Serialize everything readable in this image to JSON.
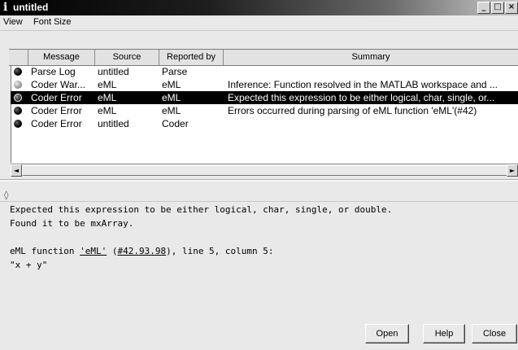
{
  "window": {
    "title": "untitled",
    "app_icon": "matlab-info-icon"
  },
  "window_buttons": {
    "minimize": "_",
    "maximize": "□",
    "close": "×"
  },
  "menu": [
    "View",
    "Font Size"
  ],
  "table": {
    "columns": [
      "Message",
      "Source",
      "Reported by",
      "Summary"
    ],
    "rows": [
      {
        "icon": "dark",
        "message": "Parse Log",
        "source": "untitled",
        "reported_by": "Parse",
        "summary": "",
        "selected": false
      },
      {
        "icon": "light",
        "message": "Coder War...",
        "source": "eML",
        "reported_by": "eML",
        "summary": "Inference: Function resolved in the MATLAB workspace and ...",
        "selected": false
      },
      {
        "icon": "dark",
        "message": "Coder Error",
        "source": "eML",
        "reported_by": "eML",
        "summary": "Expected this expression to be either logical, char, single, or...",
        "selected": true
      },
      {
        "icon": "dark",
        "message": "Coder Error",
        "source": "eML",
        "reported_by": "eML",
        "summary": "Errors occurred during parsing of eML function 'eML'(#42)",
        "selected": false
      },
      {
        "icon": "dark",
        "message": "Coder Error",
        "source": "untitled",
        "reported_by": "Coder",
        "summary": "",
        "selected": false
      }
    ]
  },
  "scroll": {
    "left": "◄",
    "right": "►"
  },
  "splitter_icon": "◊",
  "details": {
    "line1": "Expected this expression to be either logical, char, single, or double.",
    "line2": "Found it to be mxArray.",
    "line3_prefix": "eML function ",
    "line3_link1": "'eML'",
    "line3_mid": " (",
    "line3_link2": "#42.93.98",
    "line3_suffix": "), line 5, column 5:",
    "line4": "\"x + y\""
  },
  "buttons": {
    "open": "Open",
    "help": "Help",
    "close": "Close"
  }
}
